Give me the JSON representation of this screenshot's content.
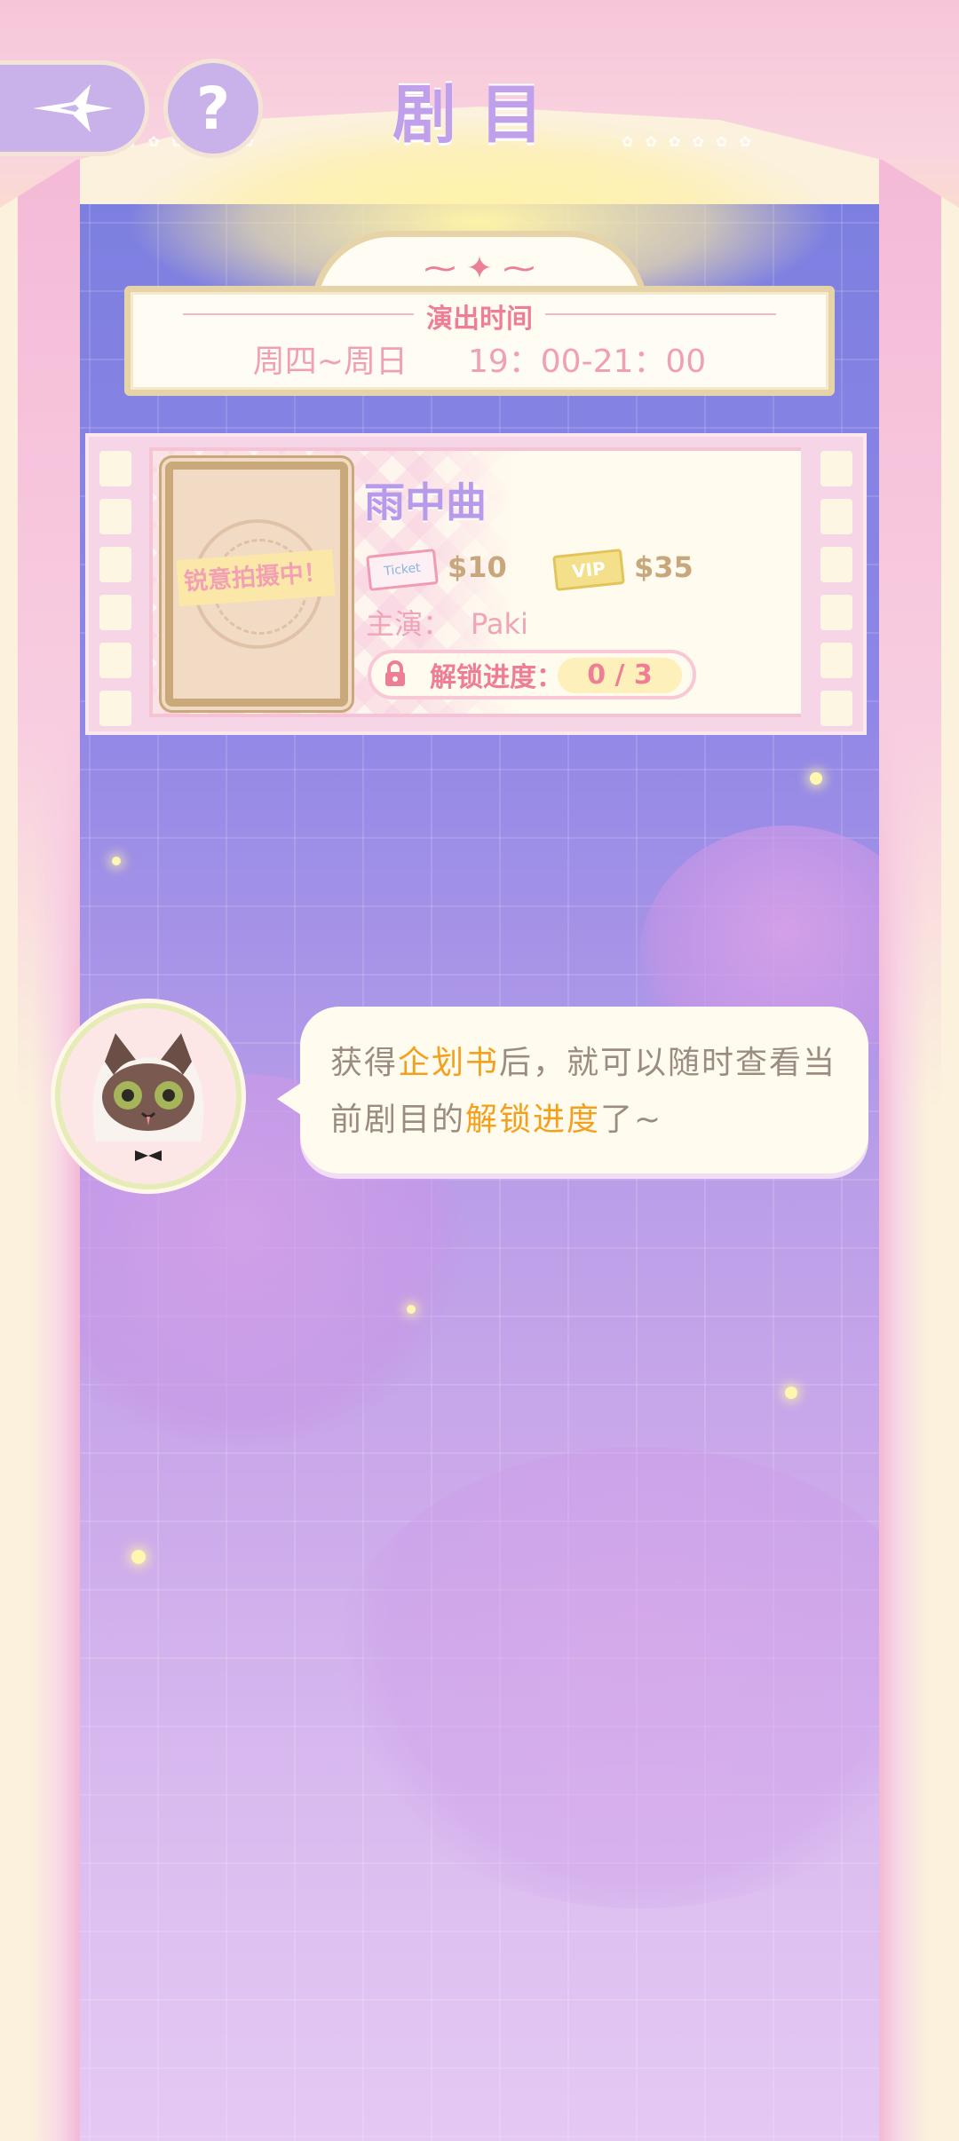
{
  "header": {
    "title": "剧目",
    "back_icon": "sparkle-star-icon",
    "help_label": "?"
  },
  "show_time": {
    "label": "演出时间",
    "days": "周四~周日",
    "hours": "19：00-21：00"
  },
  "show": {
    "title": "雨中曲",
    "poster_tag": "锐意拍摄中！",
    "normal_ticket_icon": "ticket-icon",
    "normal_ticket_text": "Ticket",
    "normal_price": "$10",
    "vip_ticket_text": "VIP",
    "vip_price": "$35",
    "lead_label": "主演：",
    "lead_name": "Paki",
    "unlock_label": "解锁进度：",
    "unlock_progress": "0 / 3",
    "unlock_current": 0,
    "unlock_total": 3
  },
  "dialog": {
    "speaker": "cat-mascot",
    "text_1": "获得",
    "text_hl_1": "企划书",
    "text_2": "后，就可以随时查看当前剧目的",
    "text_hl_2": "解锁进度",
    "text_3": "了~"
  },
  "colors": {
    "title": "#c0a0ea",
    "accent_pink": "#ee7d96",
    "highlight": "#f4a01c",
    "stage_top": "#7d7fe0",
    "stage_bottom": "#e5c9f3"
  }
}
